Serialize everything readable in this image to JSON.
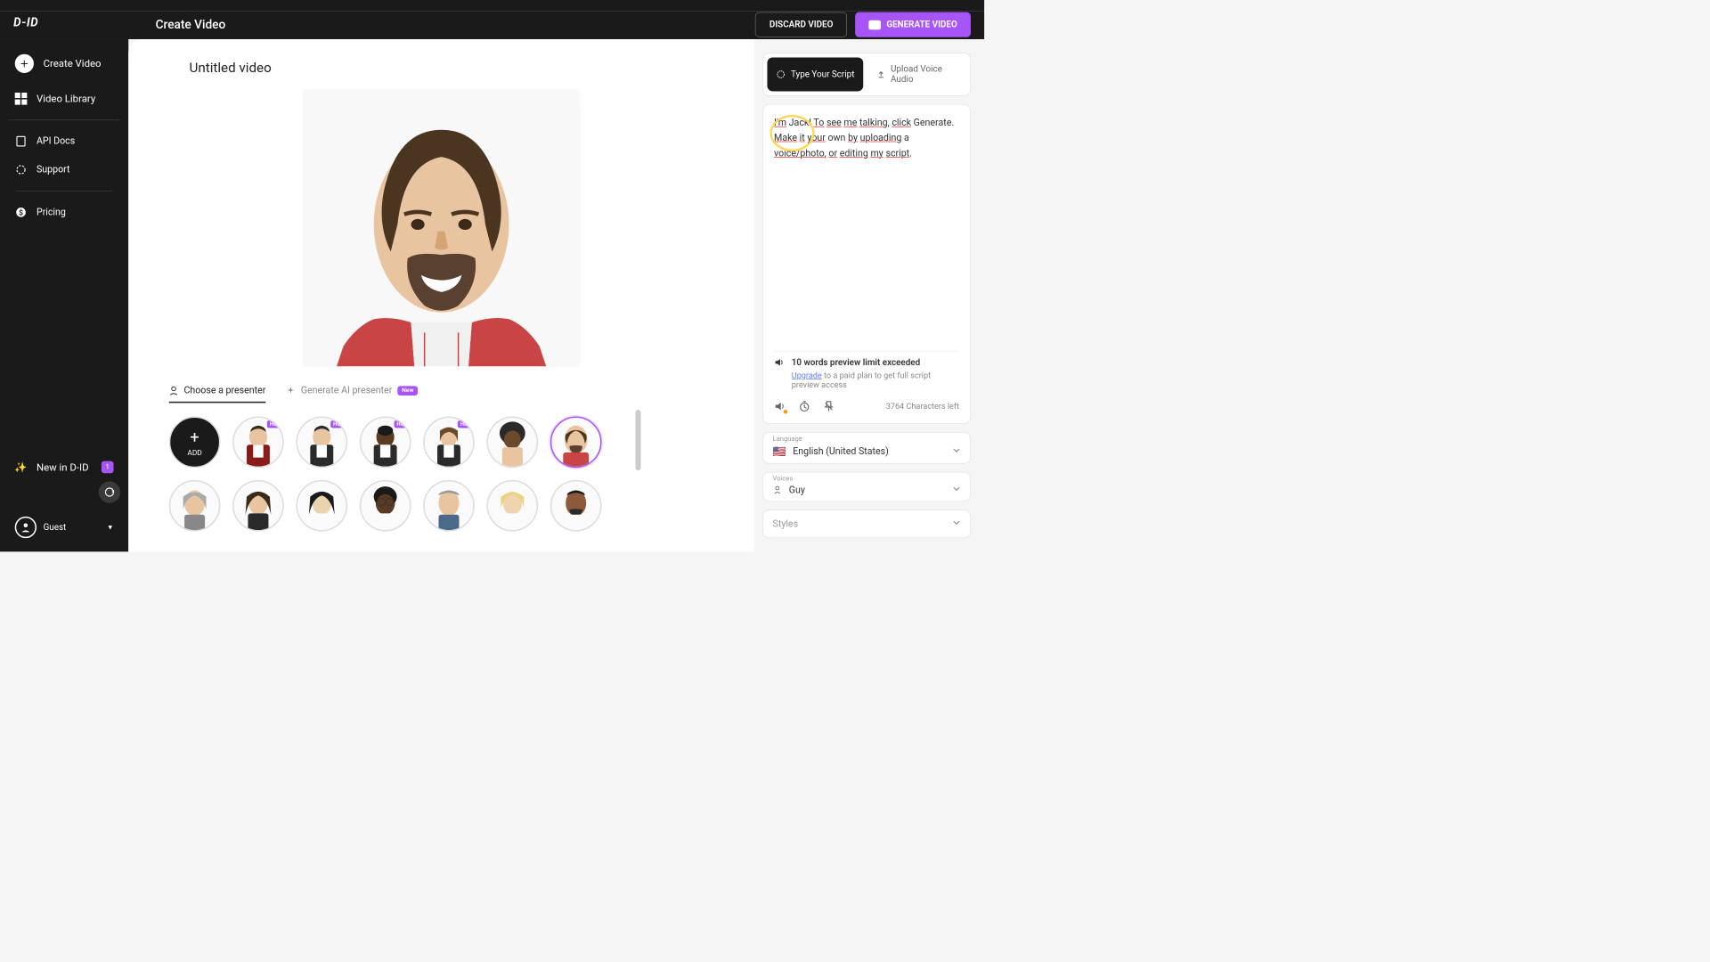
{
  "header": {
    "logo": "D-ID",
    "title": "Create Video",
    "discard": "DISCARD VIDEO",
    "generate": "GENERATE VIDEO"
  },
  "sidebar": {
    "create": "Create Video",
    "library": "Video Library",
    "api": "API Docs",
    "support": "Support",
    "pricing": "Pricing",
    "new": "New in D-ID",
    "new_count": "1",
    "user": "Guest"
  },
  "editor": {
    "title": "Untitled video",
    "tab_choose": "Choose a presenter",
    "tab_generate": "Generate AI presenter",
    "badge_new": "New",
    "add_label": "ADD",
    "hq_badge": "HQ"
  },
  "script": {
    "tab_type": "Type Your Script",
    "tab_upload": "Upload Voice Audio",
    "text_p1a": "I'm",
    "text_p1b": "Jack!",
    "text_p1c": "To",
    "text_p1d": "see",
    "text_p1e": "me",
    "text_p1f": "talking",
    "text_p1g": ", ",
    "text_p1h": "click",
    "text_p1i": " Generate.",
    "text_p2a": "Make",
    "text_p2b": "it",
    "text_p2c": "your",
    "text_p2d": "own",
    "text_p2e": "by",
    "text_p2f": "uploading",
    "text_p2g": " a ",
    "text_p2h": "voice/photo",
    "text_p2i": ", ",
    "text_p2j": "or",
    "text_p3a": "editing",
    "text_p3b": "my",
    "text_p3c": "script",
    "text_p3d": ".",
    "warn": "10 words preview limit exceeded",
    "upgrade": "Upgrade",
    "upgrade_rest": " to a paid plan to get full script preview access",
    "chars": "3764 Characters left"
  },
  "dropdowns": {
    "language_label": "Language",
    "language_value": "English (United States)",
    "language_flag": "🇺🇸",
    "voices_label": "Voices",
    "voices_value": "Guy",
    "styles_label": "Styles"
  }
}
